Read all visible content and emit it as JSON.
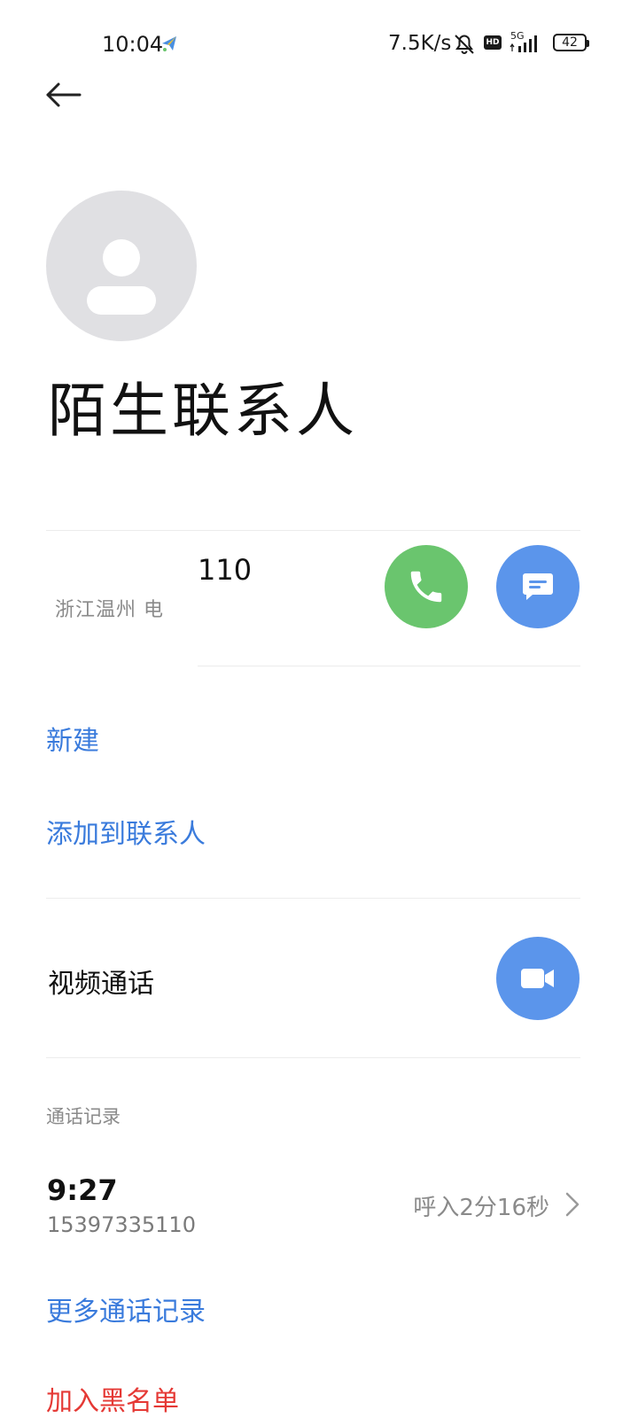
{
  "status_bar": {
    "time": "10:04",
    "net_speed": "7.5K/s",
    "signal": "5G",
    "hd": "HD",
    "battery": "42"
  },
  "contact": {
    "name": "陌生联系人",
    "phone": "110",
    "location": "浙江温州 电"
  },
  "actions": {
    "new_label": "新建",
    "add_to_contacts_label": "添加到联系人",
    "video_call_label": "视频通话"
  },
  "call_log": {
    "header": "通话记录",
    "entries": [
      {
        "time": "9:27",
        "number": "15397335110",
        "detail": "呼入2分16秒"
      }
    ],
    "more_label": "更多通话记录"
  },
  "blacklist": {
    "label": "加入黑名单"
  },
  "colors": {
    "accent_blue": "#3a7bdc",
    "call_green": "#6ac56e",
    "message_blue": "#5b95eb",
    "danger_red": "#e53935"
  },
  "icons": {
    "back": "arrow-left-icon",
    "avatar": "person-icon",
    "call": "phone-icon",
    "message": "chat-bubble-icon",
    "video": "video-camera-icon",
    "chevron": "chevron-right-icon"
  }
}
